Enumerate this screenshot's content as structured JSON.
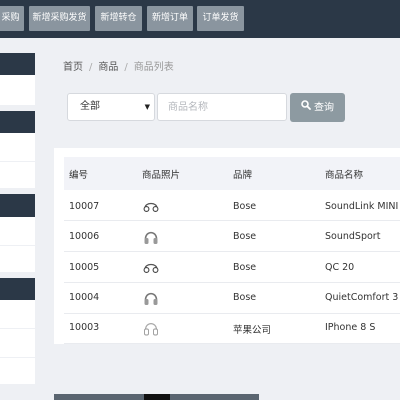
{
  "top_nav": {
    "buttons": [
      "采购",
      "新增采购发货",
      "新增转仓",
      "新增订单",
      "订单发货"
    ]
  },
  "breadcrumb": {
    "home": "首页",
    "sep": "/",
    "section": "商品",
    "current": "商品列表"
  },
  "filter": {
    "select_value": "全部",
    "select_caret": "▼",
    "input_placeholder": "商品名称",
    "search_label": "查询"
  },
  "table": {
    "headers": [
      "编号",
      "商品照片",
      "品牌",
      "商品名称"
    ],
    "rows": [
      {
        "id": "10007",
        "photo_icon": "headphones-sport-icon",
        "brand": "Bose",
        "name": "SoundLink MINI"
      },
      {
        "id": "10006",
        "photo_icon": "headphones-icon",
        "brand": "Bose",
        "name": "SoundSport"
      },
      {
        "id": "10005",
        "photo_icon": "headphones-sport-icon",
        "brand": "Bose",
        "name": "QC 20"
      },
      {
        "id": "10004",
        "photo_icon": "headphones-icon",
        "brand": "Bose",
        "name": "QuietComfort 3"
      },
      {
        "id": "10003",
        "photo_icon": "headphones-white-icon",
        "brand": "苹果公司",
        "name": "IPhone 8 S"
      }
    ]
  },
  "colors": {
    "topbar": "#2b3847",
    "top_button": "#8a959f",
    "search_button": "#8d9aa1",
    "page_bg": "#eef0f4"
  }
}
